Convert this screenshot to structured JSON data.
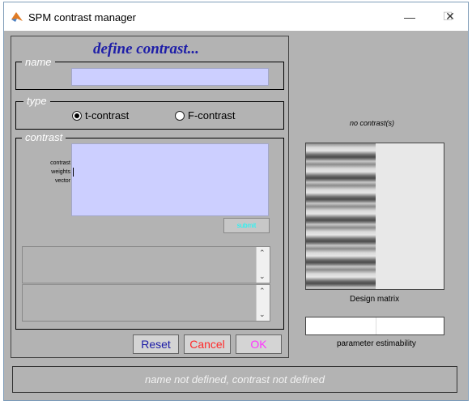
{
  "window": {
    "title": "SPM contrast manager"
  },
  "header": {
    "title": "define contrast..."
  },
  "name_group": {
    "label": "name",
    "value": ""
  },
  "type_group": {
    "label": "type",
    "options": [
      "t-contrast",
      "F-contrast"
    ],
    "selected": "t-contrast"
  },
  "contrast_group": {
    "label": "contrast",
    "weights_label_lines": [
      "contrast",
      "weights",
      "vector"
    ],
    "value": "",
    "submit_label": "submit"
  },
  "buttons": {
    "reset": "Reset",
    "cancel": "Cancel",
    "ok": "OK"
  },
  "status": "name not defined, contrast not defined",
  "right_panel": {
    "no_contrast": "no contrast(s)",
    "design_matrix_label": "Design matrix",
    "param_label": "parameter estimability"
  },
  "colors": {
    "panel_bg": "#b3b3b3",
    "input_bg": "#cccfff",
    "header_blue": "#1e1ea8",
    "reset": "#1a1aa6",
    "cancel": "#ff2a2a",
    "ok": "#ff33ff",
    "submit": "#00ffff"
  }
}
